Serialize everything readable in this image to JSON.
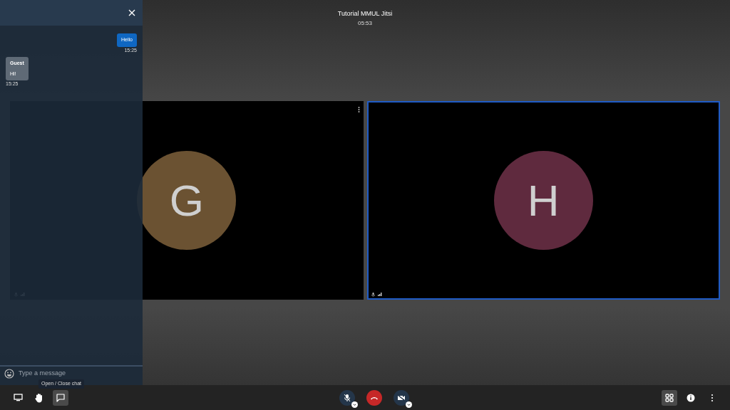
{
  "meeting": {
    "title": "Tutorial MMUL Jitsi",
    "time": "05:53"
  },
  "tiles": [
    {
      "initial": "G",
      "color": "#6b5232",
      "selected": false
    },
    {
      "initial": "H",
      "color": "#5f2a3e",
      "selected": true
    }
  ],
  "chat": {
    "open": true,
    "messages": [
      {
        "kind": "own",
        "text": "Hello",
        "time": "15:25"
      },
      {
        "kind": "other",
        "sender": "Guest",
        "text": "Hi!",
        "time": "15:25"
      }
    ],
    "placeholder": "Type a message"
  },
  "toolbar": {
    "tooltip": "Open / Close chat",
    "mic_muted": true,
    "camera_muted": true,
    "tile_view": true
  }
}
